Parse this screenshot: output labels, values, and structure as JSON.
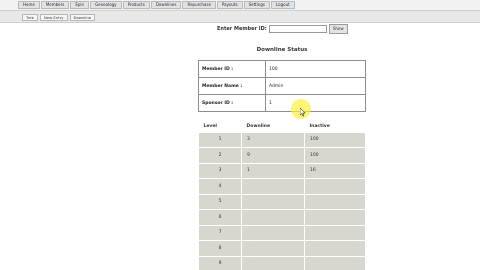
{
  "nav": {
    "items": [
      "Home",
      "Members",
      "Epin",
      "Genealogy",
      "Products",
      "Downlines",
      "Repurchase",
      "Payouts",
      "Settings",
      "Logout"
    ]
  },
  "subnav": {
    "items": [
      "Tree",
      "New Entry",
      "Downline"
    ]
  },
  "search": {
    "label": "Enter Member ID:",
    "value": "",
    "placeholder": "",
    "button": "Show"
  },
  "page": {
    "title": "Downline Status"
  },
  "info": [
    {
      "label": "Member ID :",
      "value": "100"
    },
    {
      "label": "Member Name :",
      "value": "Admin"
    },
    {
      "label": "Sponsor ID :",
      "value": "1"
    }
  ],
  "levels_table": {
    "headers": [
      "Level",
      "Downline",
      "Inactive"
    ],
    "rows": [
      {
        "level": "1",
        "downline": "3",
        "inactive": "100"
      },
      {
        "level": "2",
        "downline": "9",
        "inactive": "100"
      },
      {
        "level": "3",
        "downline": "1",
        "inactive": "16"
      },
      {
        "level": "4",
        "downline": "",
        "inactive": ""
      },
      {
        "level": "5",
        "downline": "",
        "inactive": ""
      },
      {
        "level": "6",
        "downline": "",
        "inactive": ""
      },
      {
        "level": "7",
        "downline": "",
        "inactive": ""
      },
      {
        "level": "8",
        "downline": "",
        "inactive": ""
      },
      {
        "level": "9",
        "downline": "",
        "inactive": ""
      }
    ]
  },
  "colors": {
    "nav_bg": "#dfe3e6",
    "table_cell_bg": "#d7d7cf",
    "cursor_highlight": "#fff03c"
  }
}
